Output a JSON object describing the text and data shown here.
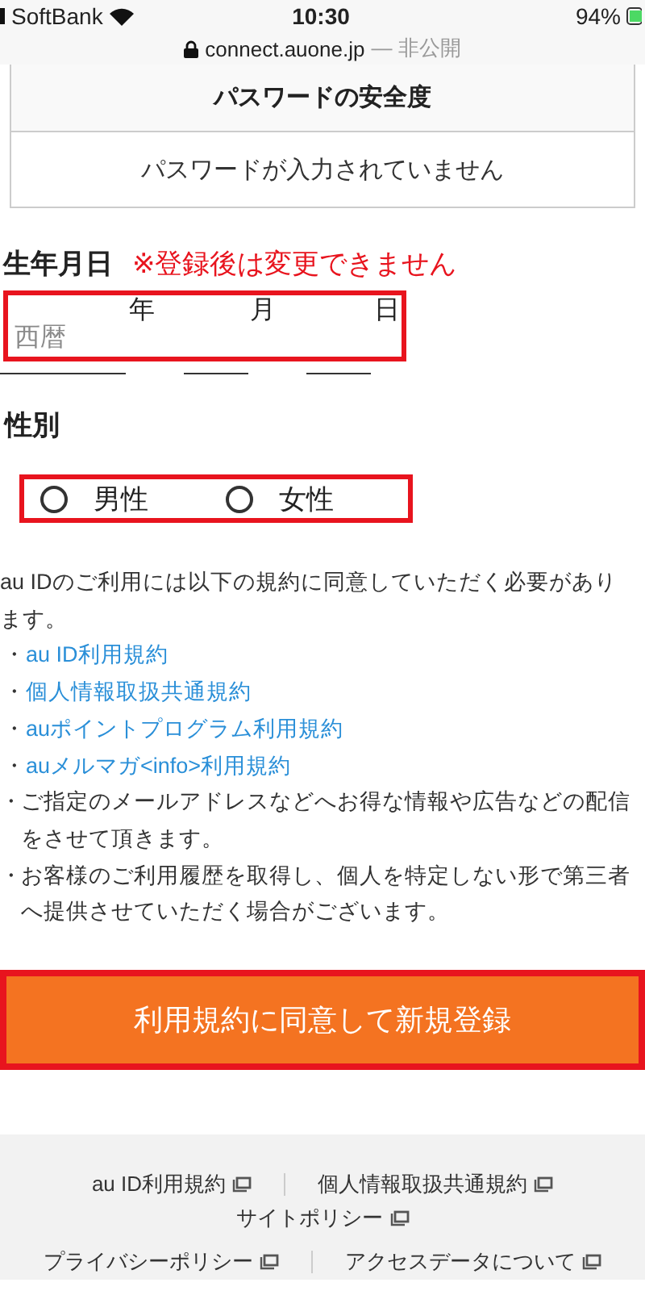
{
  "status_bar": {
    "carrier": "SoftBank",
    "time": "10:30",
    "battery": "94%"
  },
  "address_bar": {
    "domain": "connect.auone.jp",
    "note": "— 非公開"
  },
  "password_strength": {
    "title": "パスワードの安全度",
    "message": "パスワードが入力されていません"
  },
  "birthdate": {
    "label": "生年月日",
    "warning": "※登録後は変更できません",
    "fields": [
      {
        "placeholder": "西暦",
        "unit": "年"
      },
      {
        "unit": "月"
      },
      {
        "unit": "日"
      }
    ]
  },
  "gender": {
    "label": "性別",
    "options": [
      {
        "label": "男性",
        "selected": false
      },
      {
        "label": "女性",
        "selected": false
      }
    ]
  },
  "terms": {
    "intro": "au IDのご利用には以下の規約に同意していただく必要があります。",
    "items": [
      {
        "kind": "link",
        "bullet": "・",
        "text": "au ID利用規約"
      },
      {
        "kind": "link",
        "bullet": "・",
        "text": "個人情報取扱共通規約"
      },
      {
        "kind": "link",
        "bullet": "・",
        "text": "auポイントプログラム利用規約"
      },
      {
        "kind": "link",
        "bullet": "・",
        "text": "auメルマガ<info>利用規約"
      },
      {
        "kind": "note",
        "bullet": "・",
        "text": "ご指定のメールアドレスなどへお得な情報や広告などの配信をさせて頂きます。"
      },
      {
        "kind": "note",
        "bullet": "・",
        "text": "お客様のご利用履歴を取得し、個人を特定しない形で第三者へ提供させていただく場合がございます。"
      }
    ]
  },
  "submit_button": {
    "label": "利用規約に同意して新規登録"
  },
  "footer": {
    "rows": [
      {
        "links": [
          "au ID利用規約",
          "個人情報取扱共通規約"
        ]
      },
      {
        "links": [
          "サイトポリシー"
        ]
      },
      {
        "links": [
          "プライバシーポリシー",
          "アクセスデータについて"
        ]
      }
    ]
  }
}
